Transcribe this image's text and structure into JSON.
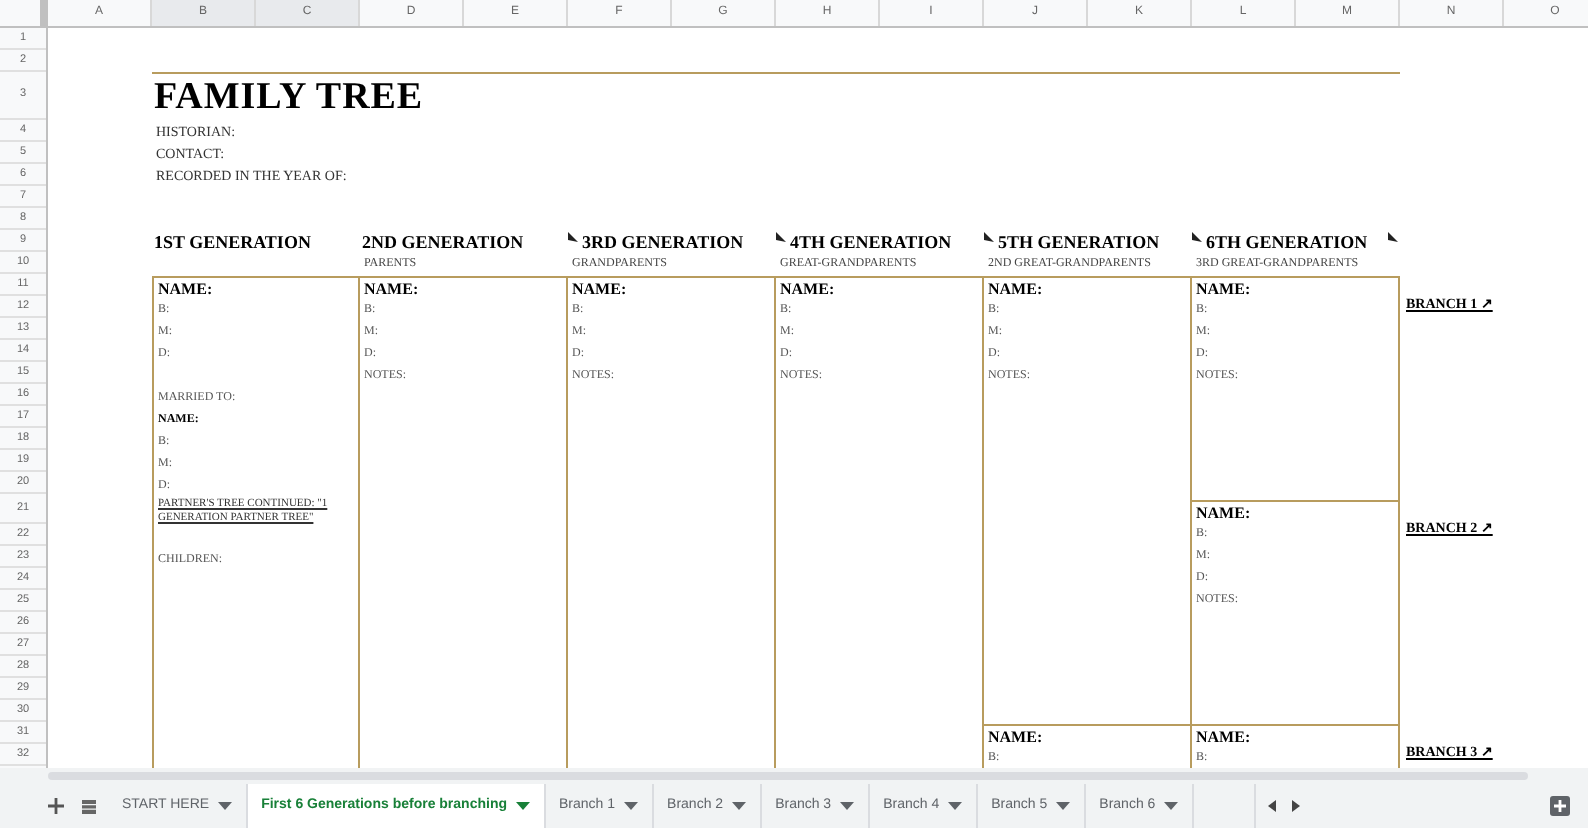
{
  "column_headers": [
    "A",
    "B",
    "C",
    "D",
    "E",
    "F",
    "G",
    "H",
    "I",
    "J",
    "K",
    "L",
    "M",
    "N",
    "O"
  ],
  "row_numbers": [
    "1",
    "2",
    "3",
    "4",
    "5",
    "6",
    "7",
    "8",
    "9",
    "10",
    "11",
    "12",
    "13",
    "14",
    "15",
    "16",
    "17",
    "18",
    "19",
    "20",
    "21",
    "22",
    "23",
    "24",
    "25",
    "26",
    "27",
    "28",
    "29",
    "30",
    "31",
    "32"
  ],
  "title": "FAMILY TREE",
  "info_lines": [
    "HISTORIAN:",
    "CONTACT:",
    "RECORDED IN THE YEAR OF:"
  ],
  "generations": [
    {
      "heading": "1ST GENERATION",
      "has_note": false,
      "boxes": [
        {
          "fields": [
            {
              "kind": "name",
              "text": "NAME:"
            },
            {
              "kind": "line",
              "text": "B:"
            },
            {
              "kind": "line",
              "text": "M:"
            },
            {
              "kind": "line",
              "text": "D:"
            },
            {
              "kind": "blank"
            },
            {
              "kind": "line",
              "text": "MARRIED TO:"
            },
            {
              "kind": "subname",
              "text": "NAME:"
            },
            {
              "kind": "line",
              "text": "B:"
            },
            {
              "kind": "line",
              "text": "M:"
            },
            {
              "kind": "line",
              "text": "D:"
            },
            {
              "kind": "link",
              "text": "PARTNER'S TREE CONTINUED: \"1 GENERATION PARTNER TREE\""
            },
            {
              "kind": "blank"
            },
            {
              "kind": "line",
              "text": "CHILDREN:"
            }
          ]
        }
      ]
    },
    {
      "heading": "2ND GENERATION",
      "subtitle": "PARENTS",
      "has_note": false,
      "boxes": [
        {
          "fields": [
            {
              "kind": "name",
              "text": "NAME:"
            },
            {
              "kind": "line",
              "text": "B:"
            },
            {
              "kind": "line",
              "text": "M:"
            },
            {
              "kind": "line",
              "text": "D:"
            },
            {
              "kind": "line",
              "text": "NOTES:"
            }
          ]
        }
      ]
    },
    {
      "heading": "3RD GENERATION",
      "subtitle": "GRANDPARENTS",
      "has_note": true,
      "boxes": [
        {
          "fields": [
            {
              "kind": "name",
              "text": "NAME:"
            },
            {
              "kind": "line",
              "text": "B:"
            },
            {
              "kind": "line",
              "text": "M:"
            },
            {
              "kind": "line",
              "text": "D:"
            },
            {
              "kind": "line",
              "text": "NOTES:"
            }
          ]
        }
      ]
    },
    {
      "heading": "4TH GENERATION",
      "subtitle": "GREAT-GRANDPARENTS",
      "has_note": true,
      "boxes": [
        {
          "fields": [
            {
              "kind": "name",
              "text": "NAME:"
            },
            {
              "kind": "line",
              "text": "B:"
            },
            {
              "kind": "line",
              "text": "M:"
            },
            {
              "kind": "line",
              "text": "D:"
            },
            {
              "kind": "line",
              "text": "NOTES:"
            }
          ]
        }
      ]
    },
    {
      "heading": "5TH GENERATION",
      "subtitle": "2ND GREAT-GRANDPARENTS",
      "has_note": true,
      "boxes": [
        {
          "fields": [
            {
              "kind": "name",
              "text": "NAME:"
            },
            {
              "kind": "line",
              "text": "B:"
            },
            {
              "kind": "line",
              "text": "M:"
            },
            {
              "kind": "line",
              "text": "D:"
            },
            {
              "kind": "line",
              "text": "NOTES:"
            }
          ]
        },
        {
          "fields": [
            {
              "kind": "name",
              "text": "NAME:"
            },
            {
              "kind": "line",
              "text": "B:"
            }
          ]
        }
      ]
    },
    {
      "heading": "6TH GENERATION",
      "subtitle": "3RD GREAT-GRANDPARENTS",
      "has_note": true,
      "boxes": [
        {
          "fields": [
            {
              "kind": "name",
              "text": "NAME:"
            },
            {
              "kind": "line",
              "text": "B:"
            },
            {
              "kind": "line",
              "text": "M:"
            },
            {
              "kind": "line",
              "text": "D:"
            },
            {
              "kind": "line",
              "text": "NOTES:"
            }
          ]
        },
        {
          "fields": [
            {
              "kind": "name",
              "text": "NAME:"
            },
            {
              "kind": "line",
              "text": "B:"
            },
            {
              "kind": "line",
              "text": "M:"
            },
            {
              "kind": "line",
              "text": "D:"
            },
            {
              "kind": "line",
              "text": "NOTES:"
            }
          ]
        },
        {
          "fields": [
            {
              "kind": "name",
              "text": "NAME:"
            },
            {
              "kind": "line",
              "text": "B:"
            }
          ]
        }
      ]
    }
  ],
  "trailing_note": true,
  "branch_links": [
    "BRANCH 1 ↗",
    "BRANCH 2 ↗",
    "BRANCH 3 ↗"
  ],
  "sheet_tabs": [
    {
      "label": "START HERE",
      "selected": false
    },
    {
      "label": "First 6 Generations before branching",
      "selected": true
    },
    {
      "label": "Branch 1",
      "selected": false
    },
    {
      "label": "Branch 2",
      "selected": false
    },
    {
      "label": "Branch 3",
      "selected": false
    },
    {
      "label": "Branch 4",
      "selected": false
    },
    {
      "label": "Branch 5",
      "selected": false
    },
    {
      "label": "Branch 6",
      "selected": false
    }
  ]
}
